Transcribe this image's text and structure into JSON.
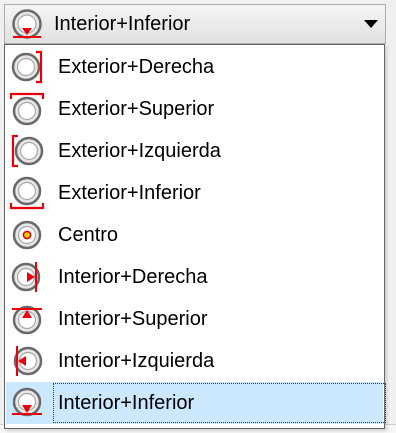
{
  "combo": {
    "selected_label": "Interior+Inferior",
    "selected_icon": "circle-interior-bottom-icon"
  },
  "options": [
    {
      "label": "Exterior+Derecha",
      "icon": "circle-exterior-right-icon"
    },
    {
      "label": "Exterior+Superior",
      "icon": "circle-exterior-top-icon"
    },
    {
      "label": "Exterior+Izquierda",
      "icon": "circle-exterior-left-icon"
    },
    {
      "label": "Exterior+Inferior",
      "icon": "circle-exterior-bottom-icon"
    },
    {
      "label": "Centro",
      "icon": "circle-center-icon"
    },
    {
      "label": "Interior+Derecha",
      "icon": "circle-interior-right-icon"
    },
    {
      "label": "Interior+Superior",
      "icon": "circle-interior-top-icon"
    },
    {
      "label": "Interior+Izquierda",
      "icon": "circle-interior-left-icon"
    },
    {
      "label": "Interior+Inferior",
      "icon": "circle-interior-bottom-icon",
      "selected": true
    }
  ],
  "colors": {
    "marker": "#e8000b",
    "ring_outer": "#707070",
    "selection_bg": "#cce8ff"
  }
}
